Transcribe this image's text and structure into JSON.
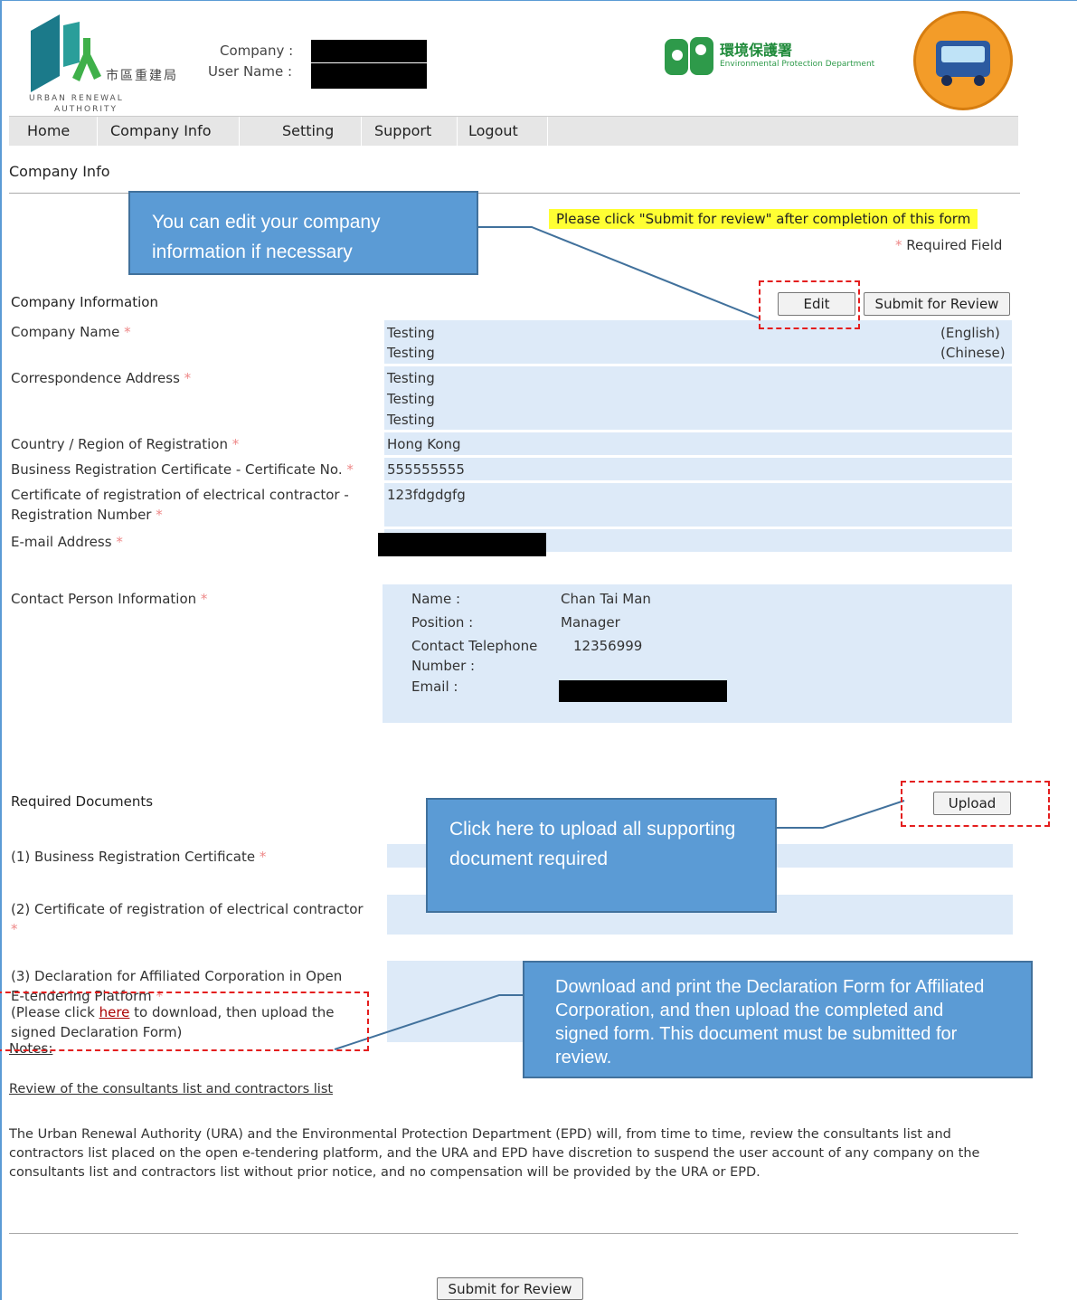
{
  "header": {
    "ura_name_cn": "市區重建局",
    "ura_name_en_1": "URBAN RENEWAL",
    "ura_name_en_2": "AUTHORITY",
    "company_label": "Company :",
    "user_label": "User Name :",
    "epd_name_cn": "環境保護署",
    "epd_name_en": "Environmental Protection Department"
  },
  "nav": {
    "items": [
      {
        "label": "Home"
      },
      {
        "label": "Company Info"
      },
      {
        "label": "Setting"
      },
      {
        "label": "Support"
      },
      {
        "label": "Logout"
      }
    ]
  },
  "page": {
    "title": "Company Info",
    "notice": "Please click \"Submit for review\" after completion of this form",
    "required_field": "Required Field",
    "required_star": "*"
  },
  "company_info": {
    "section_title": "Company Information",
    "edit_label": "Edit",
    "submit_label": "Submit for Review",
    "fields": {
      "company_name_label": "Company Name",
      "company_name_en": "Testing",
      "company_name_cn": "Testing",
      "company_name_en_tag": "(English)",
      "company_name_cn_tag": "(Chinese)",
      "address_label": "Correspondence Address",
      "address_1": "Testing",
      "address_2": "Testing",
      "address_3": "Testing",
      "country_label": "Country / Region of Registration",
      "country_value": "Hong Kong",
      "brc_label": "Business Registration Certificate - Certificate No.",
      "brc_value": "555555555",
      "electrical_label_1": "Certificate of registration of electrical contractor -",
      "electrical_label_2": "Registration Number",
      "electrical_value": "123fdgdgfg",
      "email_label": "E-mail Address"
    }
  },
  "contact": {
    "section_label": "Contact Person Information",
    "name_label": "Name :",
    "name_value": "Chan Tai Man",
    "position_label": "Position :",
    "position_value": "Manager",
    "tel_label_1": "Contact Telephone",
    "tel_label_2": "Number :",
    "tel_value": "12356999",
    "email_label": "Email :"
  },
  "documents": {
    "section_title": "Required Documents",
    "upload_label": "Upload",
    "doc1": "(1) Business Registration Certificate",
    "doc2": "(2) Certificate of registration of electrical contractor",
    "doc3_1": "(3) Declaration for Affiliated Corporation in Open",
    "doc3_2": "E-tendering Platform",
    "download_pre": "(Please click ",
    "download_link": "here",
    "download_post": " to download, then upload the",
    "download_line2": "signed Declaration Form)"
  },
  "notes": {
    "title": "Notes:",
    "subtitle": "Review of the consultants list and contractors list",
    "paragraph": "The Urban Renewal Authority (URA) and the Environmental Protection Department (EPD) will, from time to time, review the consultants list and contractors list placed on the open e-tendering platform, and the URA and EPD have discretion to suspend the user account of any company on the consultants list and contractors list without prior notice, and no compensation will be provided by the URA or EPD."
  },
  "footer": {
    "submit_label": "Submit for Review"
  },
  "callouts": {
    "edit": "You can edit your company information if necessary",
    "upload": "Click here to upload all supporting document required",
    "declaration": "Download and print the Declaration Form for Affiliated Corporation, and then upload the completed and signed form.  This document must be submitted for review."
  },
  "colors": {
    "callout_fill": "#5b9bd5",
    "field_bg": "#ddeaf8",
    "notice_bg": "#ffff33",
    "dashed_highlight": "#e41e1e",
    "nav_bg": "#e6e6e6"
  }
}
